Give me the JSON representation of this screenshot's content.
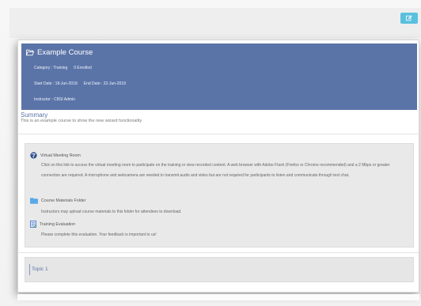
{
  "course": {
    "title": "Example Course",
    "category": "Category : Training",
    "enrolled": "0 Enrolled",
    "start_date": "Start Date : 18-Jun-2018",
    "end_date": "End Date : 22-Jun-2018",
    "instructor": "Instructor : CBSI Admin"
  },
  "summary": {
    "title": "Summary",
    "text": "This is an example course to show the new wizard functionality"
  },
  "resources": [
    {
      "icon": "globe-icon",
      "label": "Virtual Meeting Room",
      "description": "Click on this link to access the virtual meeting room to participate on the training or view recorded content. A web browser with Adobe Flash (Firefox or Chrome recommended) and a 2 Mbps or greater connection are required. A microphone and webcamera are needed to transmit audio and video but are not required for participants to listen and communicate through text chat."
    },
    {
      "icon": "folder-icon",
      "label": "Course Materials Folder",
      "description": "Instructors may upload course materials to this folder for attendees to download."
    },
    {
      "icon": "evaluation-icon",
      "label": "Training Evaluation",
      "description": "Please complete this evaluation. Your feedback is important to us!"
    }
  ],
  "topics": [
    {
      "label": "Topic 1"
    }
  ],
  "colors": {
    "header": "#5b74a8",
    "edit_button": "#5bc0de",
    "folder": "#5aa9e6"
  }
}
